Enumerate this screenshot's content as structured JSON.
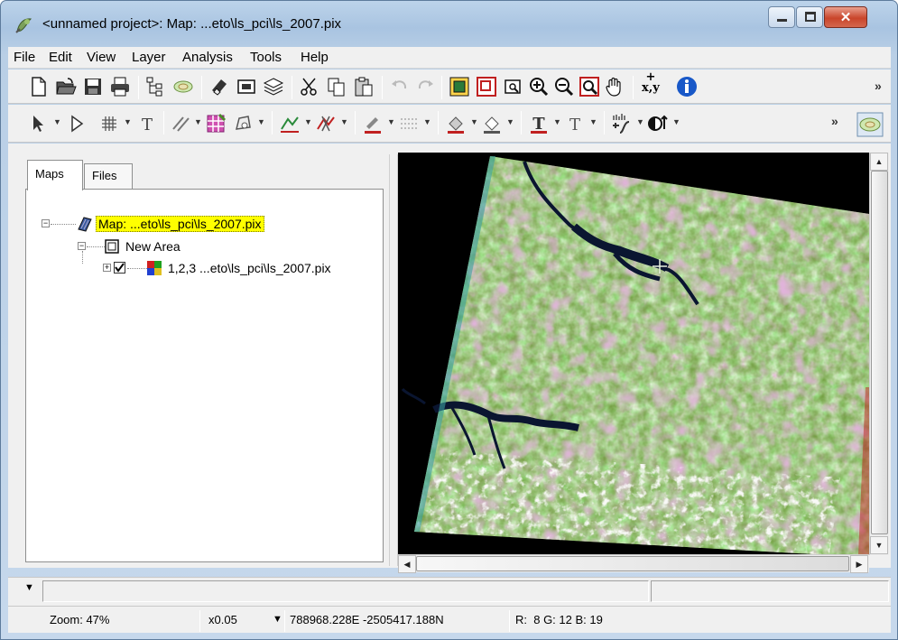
{
  "window": {
    "title": "<unnamed project>: Map: ...eto\\ls_pci\\ls_2007.pix",
    "controls": {
      "minimize": "–",
      "maximize": "□",
      "close": "✕"
    }
  },
  "menubar": {
    "items": [
      "File",
      "Edit",
      "View",
      "Layer",
      "Analysis",
      "Tools",
      "Help"
    ]
  },
  "toolbar1": {
    "icons": [
      "new-file-icon",
      "open-folder-icon",
      "save-icon",
      "print-icon",
      "hierarchy-icon",
      "layer-view-icon",
      "eraser-icon",
      "frame-icon",
      "layers-stack-icon",
      "cut-icon",
      "copy-icon",
      "paste-icon",
      "undo-icon",
      "redo-icon",
      "zoom-extent-icon",
      "zoom-window-icon",
      "zoom-box-icon",
      "zoom-in-icon",
      "zoom-out-icon",
      "zoom-layer-icon",
      "pan-hand-icon",
      "coordinates-icon",
      "info-icon"
    ],
    "coord_label_top": "+",
    "coord_label": "x,y",
    "more": "»"
  },
  "toolbar2": {
    "more": "»"
  },
  "tabs": {
    "maps": "Maps",
    "files": "Files"
  },
  "tree": {
    "map_node": "Map: ...eto\\ls_pci\\ls_2007.pix",
    "area_node": "New Area",
    "layer_node": "1,2,3 ...eto\\ls_pci\\ls_2007.pix",
    "expander_minus": "−",
    "expander_plus": "+"
  },
  "status": {
    "zoom": "Zoom: 47%",
    "scale": "x0.05",
    "coords": "788968.228E -2505417.188N",
    "rgb": "R:  8 G: 12 B: 19"
  },
  "colors": {
    "title_bar": "#a9c4e1",
    "map_label_highlight": "#ffff00",
    "imagery_green": "#6f9a3c",
    "water": "#0a1530"
  }
}
